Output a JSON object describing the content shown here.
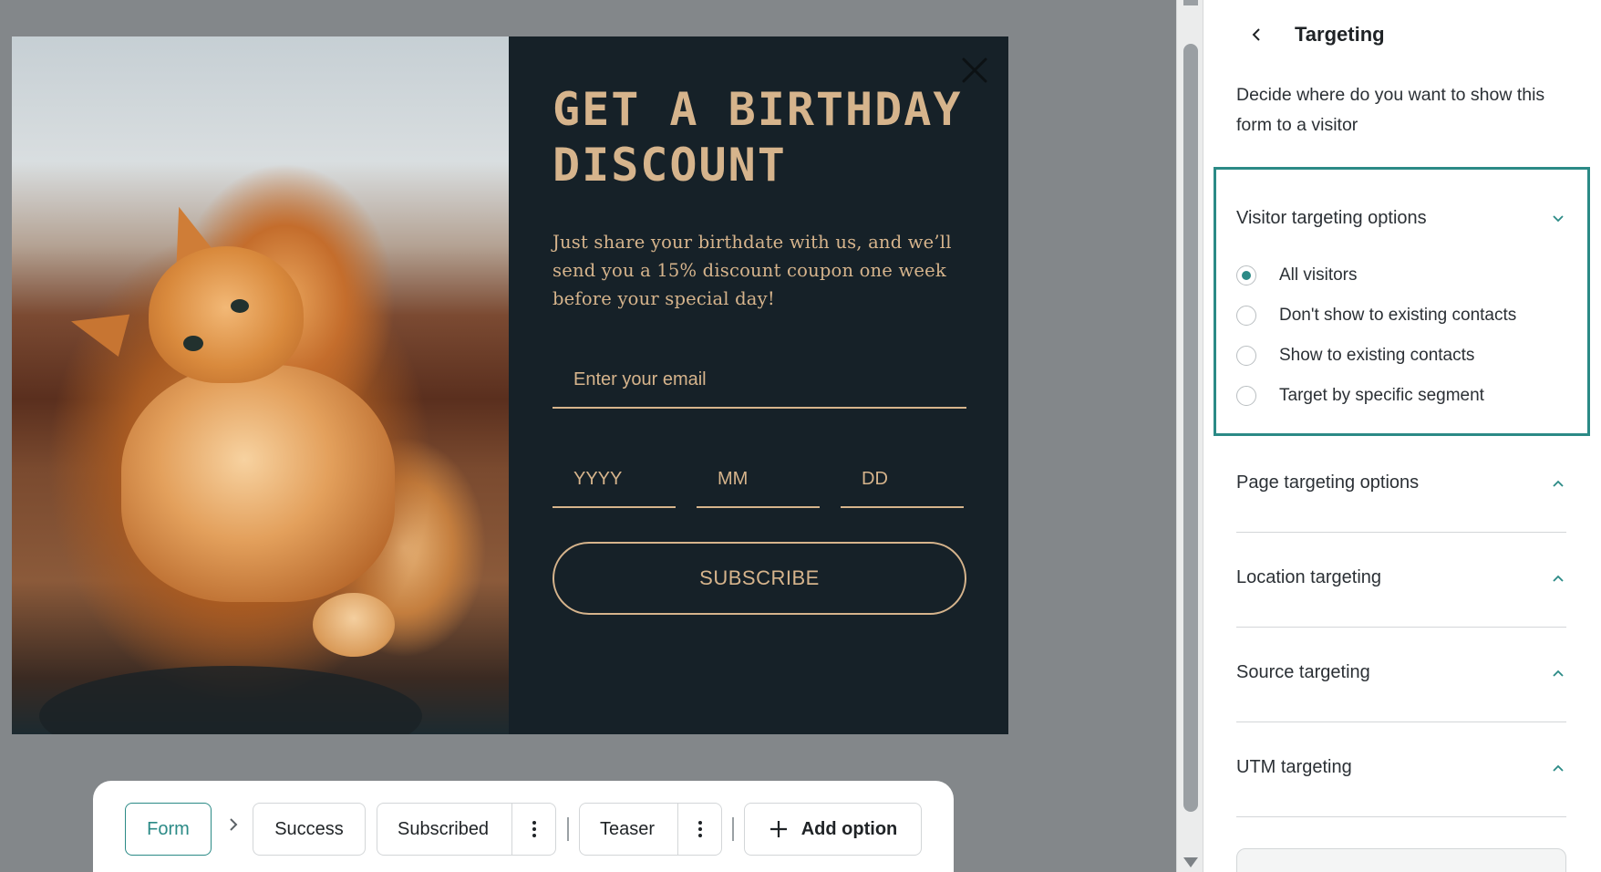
{
  "popup": {
    "headline": "GET A BIRTHDAY DISCOUNT",
    "subtext": "Just share your birthdate with us, and we’ll send you a 15% discount coupon one week before your special day!",
    "email_placeholder": "Enter your email",
    "date_fields": {
      "year": "YYYY",
      "month": "MM",
      "day": "DD"
    },
    "subscribe_label": "SUBSCRIBE",
    "colors": {
      "background": "#162128",
      "accent": "#d6b48c"
    }
  },
  "steps": {
    "form": "Form",
    "success": "Success",
    "subscribed": "Subscribed",
    "teaser": "Teaser",
    "add_option": "Add option"
  },
  "panel": {
    "title": "Targeting",
    "description": "Decide where do you want to show this form to a visitor",
    "visitor_section": {
      "title": "Visitor targeting options",
      "options": [
        {
          "label": "All visitors",
          "checked": true
        },
        {
          "label": "Don't show to existing contacts",
          "checked": false
        },
        {
          "label": "Show to existing contacts",
          "checked": false
        },
        {
          "label": "Target by specific segment",
          "checked": false
        }
      ]
    },
    "sections": [
      {
        "title": "Page targeting options"
      },
      {
        "title": "Location targeting"
      },
      {
        "title": "Source targeting"
      },
      {
        "title": "UTM targeting"
      }
    ],
    "accent_color": "#2b8a86"
  }
}
